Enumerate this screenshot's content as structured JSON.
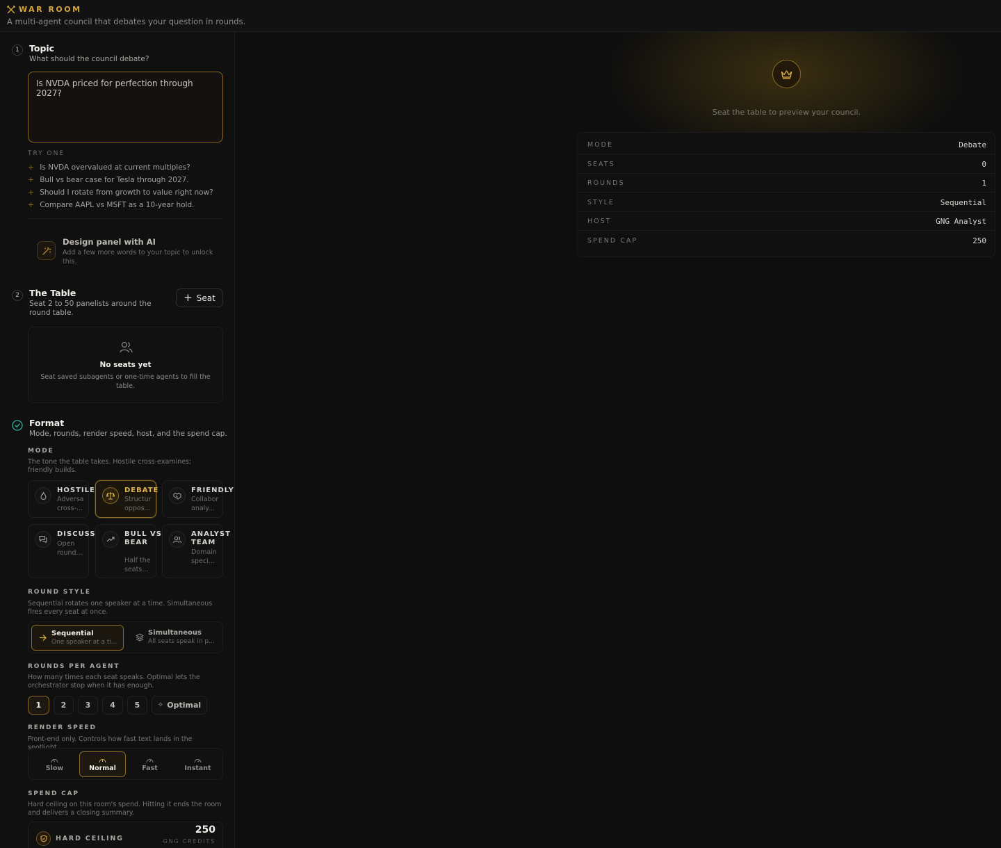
{
  "header": {
    "title": "WAR ROOM",
    "subtitle": "A multi-agent council that debates your question in rounds."
  },
  "topic": {
    "step": "1",
    "title": "Topic",
    "subtitle": "What should the council debate?",
    "value": "Is NVDA priced for perfection through 2027?",
    "try_label": "TRY ONE",
    "suggestions": [
      "Is NVDA overvalued at current multiples?",
      "Bull vs bear case for Tesla through 2027.",
      "Should I rotate from growth to value right now?",
      "Compare AAPL vs MSFT as a 10-year hold."
    ],
    "ai_title": "Design panel with AI",
    "ai_desc": "Add a few more words to your topic to unlock this."
  },
  "table": {
    "step": "2",
    "title": "The Table",
    "subtitle": "Seat 2 to 50 panelists around the round table.",
    "seat_button": "Seat",
    "empty_title": "No seats yet",
    "empty_desc": "Seat saved subagents or one-time agents to fill the table."
  },
  "format": {
    "title": "Format",
    "subtitle": "Mode, rounds, render speed, host, and the spend cap.",
    "mode_label": "MODE",
    "mode_desc": "The tone the table takes. Hostile cross-examines; friendly builds.",
    "modes": [
      {
        "name": "HOSTILE",
        "desc": "Adversa cross-...",
        "icon": "flame-icon"
      },
      {
        "name": "DEBATE",
        "desc": "Structur oppos...",
        "icon": "scale-icon"
      },
      {
        "name": "FRIENDLY",
        "desc": "Collabor analy...",
        "icon": "handshake-icon"
      },
      {
        "name": "DISCUSS",
        "desc": "Open round...",
        "icon": "chat-icon"
      },
      {
        "name": "BULL VS BEAR",
        "desc": "Half the seats...",
        "icon": "trend-icon"
      },
      {
        "name": "ANALYST TEAM",
        "desc": "Domain speci...",
        "icon": "users-icon"
      }
    ],
    "round_style_label": "ROUND STYLE",
    "round_style_desc": "Sequential rotates one speaker at a time. Simultaneous fires every seat at once.",
    "styles": [
      {
        "title": "Sequential",
        "desc": "One speaker at a ti..."
      },
      {
        "title": "Simultaneous",
        "desc": "All seats speak in p..."
      }
    ],
    "rounds_label": "ROUNDS PER AGENT",
    "rounds_desc": "How many times each seat speaks. Optimal lets the orchestrator stop when it has enough.",
    "rounds": [
      "1",
      "2",
      "3",
      "4",
      "5"
    ],
    "optimal": "Optimal",
    "speed_label": "RENDER SPEED",
    "speed_desc": "Front-end only. Controls how fast text lands in the spotlight.",
    "speeds": [
      "Slow",
      "Normal",
      "Fast",
      "Instant"
    ],
    "cap_label": "SPEND CAP",
    "cap_desc": "Hard ceiling on this room's spend. Hitting it ends the room and delivers a closing summary.",
    "cap_name": "HARD CEILING",
    "cap_value": "250",
    "cap_unit": "GNG CREDITS"
  },
  "preview": {
    "hint": "Seat the table to preview your council.",
    "rows": [
      {
        "k": "MODE",
        "v": "Debate"
      },
      {
        "k": "SEATS",
        "v": "0"
      },
      {
        "k": "ROUNDS",
        "v": "1"
      },
      {
        "k": "STYLE",
        "v": "Sequential"
      },
      {
        "k": "HOST",
        "v": "GNG Analyst"
      },
      {
        "k": "SPEND CAP",
        "v": "250"
      }
    ]
  },
  "colors": {
    "accent": "#d4a53a",
    "success": "#2fb39a",
    "background": "#0f0f0f"
  }
}
